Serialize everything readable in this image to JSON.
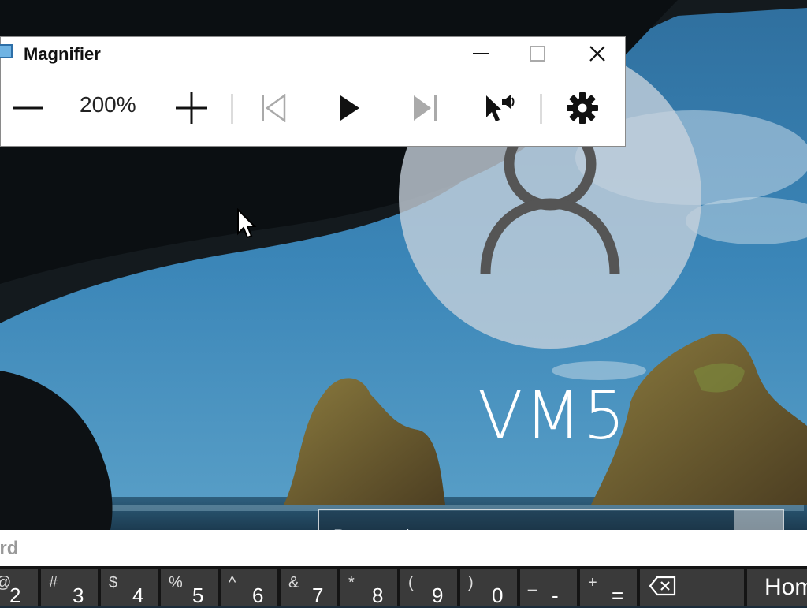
{
  "lock_screen": {
    "username": "VM5",
    "password_placeholder": "Password",
    "avatar_icon": "person-icon"
  },
  "magnifier": {
    "title": "Magnifier",
    "zoom_level": "200%",
    "icons": {
      "zoom_out": "minus-icon",
      "zoom_in": "plus-icon",
      "previous": "skip-back-icon",
      "play": "play-icon",
      "next": "skip-forward-icon",
      "read_from_here": "cursor-speaker-icon",
      "settings": "gear-icon"
    }
  },
  "keyboard": {
    "title": "ard",
    "keys": [
      {
        "secondary": "@",
        "primary": "2"
      },
      {
        "secondary": "#",
        "primary": "3"
      },
      {
        "secondary": "$",
        "primary": "4"
      },
      {
        "secondary": "%",
        "primary": "5"
      },
      {
        "secondary": "^",
        "primary": "6"
      },
      {
        "secondary": "&",
        "primary": "7"
      },
      {
        "secondary": "*",
        "primary": "8"
      },
      {
        "secondary": "(",
        "primary": "9"
      },
      {
        "secondary": ")",
        "primary": "0"
      },
      {
        "secondary": "_",
        "primary": "-"
      },
      {
        "secondary": "+",
        "primary": "="
      }
    ],
    "home_label": "Home",
    "backspace_icon": "backspace-icon"
  }
}
